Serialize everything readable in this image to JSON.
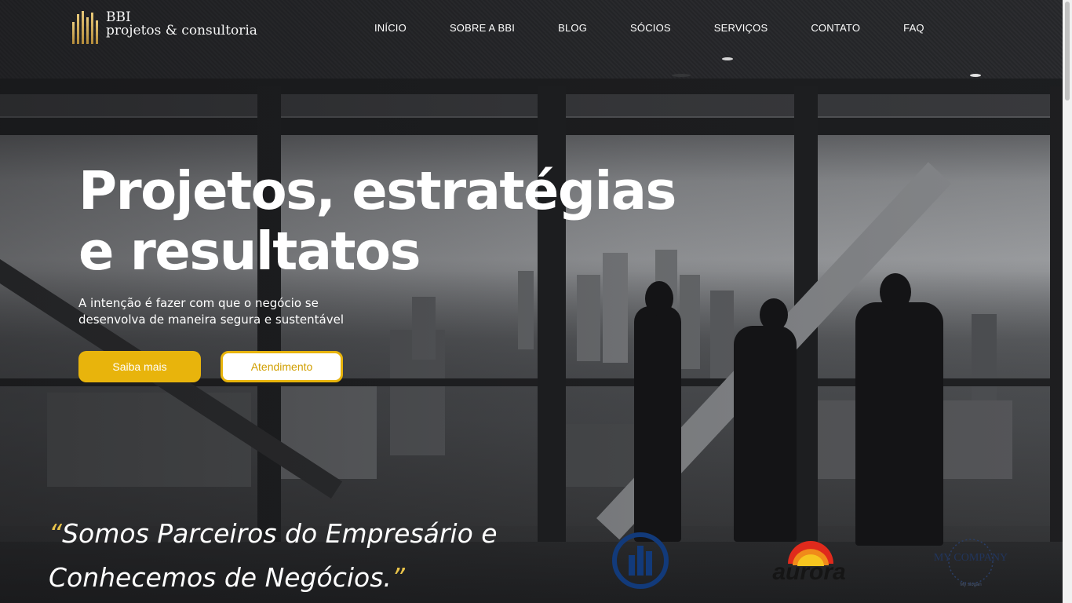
{
  "brand": {
    "name_line1": "BBI",
    "name_line2": "projetos & consultoria",
    "logo_icon": "gold-bars-icon"
  },
  "nav": {
    "items": [
      {
        "label": "INÍCIO"
      },
      {
        "label": "SOBRE A BBI"
      },
      {
        "label": "BLOG"
      },
      {
        "label": "SÓCIOS"
      },
      {
        "label": "SERVIÇOS"
      },
      {
        "label": "CONTATO"
      },
      {
        "label": "FAQ"
      }
    ]
  },
  "hero": {
    "headline_line1": "Projetos, estratégias",
    "headline_line2": "e resultatos",
    "subtitle_line1": "A intenção é fazer com que o negócio se",
    "subtitle_line2": "desenvolva de maneira segura e sustentável",
    "primary_button": "Saiba mais",
    "secondary_button": "Atendimento",
    "background_image": "office-city-skyline-photo"
  },
  "quote": {
    "open_mark": "“",
    "line1": "Somos Parceiros do Empresário e",
    "line2": "Conhecemos de Negócios.",
    "close_mark": "”"
  },
  "partners": [
    {
      "name": "allianz-logo"
    },
    {
      "text": "aurora"
    },
    {
      "text": "MY COMPANY",
      "slogan": "My slogan"
    }
  ],
  "colors": {
    "accent": "#e8b40c",
    "accent_text": "#d19f00",
    "quote_mark": "#e8c34a"
  }
}
